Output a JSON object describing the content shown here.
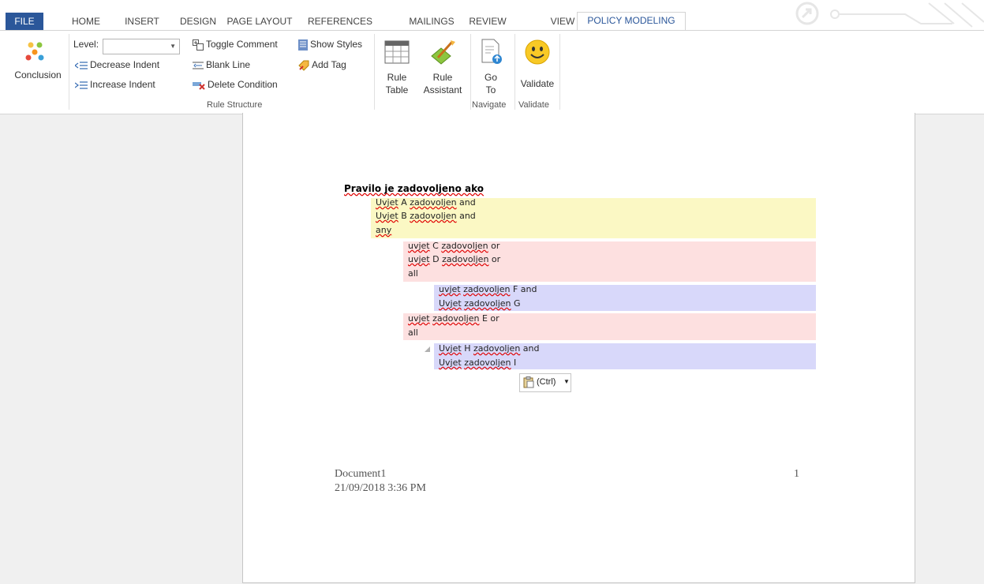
{
  "tabs": {
    "file": "FILE",
    "home": "HOME",
    "insert": "INSERT",
    "design": "DESIGN",
    "page_layout": "PAGE LAYOUT",
    "references": "REFERENCES",
    "mailings": "MAILINGS",
    "review": "REVIEW",
    "view": "VIEW",
    "policy_modeling": "POLICY MODELING"
  },
  "ribbon": {
    "conclusion": "Conclusion",
    "level_label": "Level:",
    "level_value": "",
    "decrease_indent": "Decrease Indent",
    "increase_indent": "Increase Indent",
    "toggle_comment": "Toggle Comment",
    "blank_line": "Blank Line",
    "delete_condition": "Delete Condition",
    "show_styles": "Show Styles",
    "add_tag": "Add Tag",
    "rule_table_1": "Rule",
    "rule_table_2": "Table",
    "rule_assistant_1": "Rule",
    "rule_assistant_2": "Assistant",
    "goto_1": "Go",
    "goto_2": "To",
    "validate": "Validate",
    "group_rule_structure": "Rule Structure",
    "group_navigate": "Navigate",
    "group_validate": "Validate"
  },
  "document": {
    "heading": "Pravilo je zadovoljeno ako",
    "lines": [
      {
        "w1": "Uvjet",
        "rest": " A ",
        "w2": "zadovoljen",
        "tail": " and"
      },
      {
        "w1": "Uvjet",
        "rest": " B ",
        "w2": "zadovoljen",
        "tail": " and"
      },
      {
        "w1": "any",
        "rest": "",
        "w2": "",
        "tail": ""
      },
      {
        "w1": "uvjet",
        "rest": " C ",
        "w2": "zadovoljen",
        "tail": " or"
      },
      {
        "w1": "uvjet",
        "rest": " D ",
        "w2": "zadovoljen",
        "tail": " or"
      },
      {
        "w1": "all",
        "rest": "",
        "w2": "",
        "tail": ""
      },
      {
        "w1": "uvjet",
        "rest": " ",
        "w2": "zadovoljen",
        "tail": " F and"
      },
      {
        "w1": "Uvjet",
        "rest": " ",
        "w2": "zadovoljen",
        "tail": " G"
      },
      {
        "w1": "uvjet",
        "rest": " ",
        "w2": "zadovoljen",
        "tail": " E or"
      },
      {
        "w1": "all",
        "rest": "",
        "w2": "",
        "tail": ""
      },
      {
        "w1": "Uvjet",
        "rest": " H ",
        "w2": "zadovoljen",
        "tail": " and"
      },
      {
        "w1": "Uvjet",
        "rest": " ",
        "w2": "zadovoljen",
        "tail": " I"
      }
    ],
    "paste_options": "(Ctrl)",
    "footer_name": "Document1",
    "footer_date": "21/09/2018 3:36 PM",
    "page_number": "1"
  },
  "colors": {
    "file_tab": "#2b579a",
    "yellow_block": "#fbf8c4",
    "pink_block": "#fde0e0",
    "blue_block": "#d8d8fa"
  }
}
